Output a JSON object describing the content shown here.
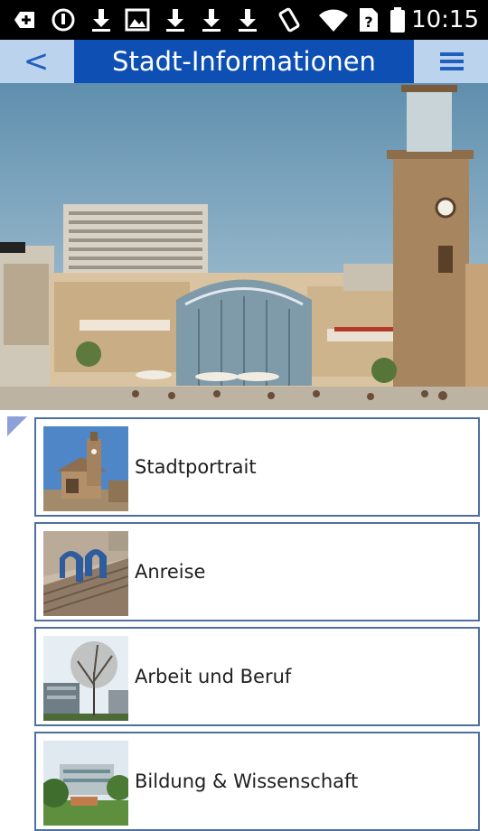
{
  "status_bar": {
    "time": "10:15",
    "icons": [
      "notification-plus-icon",
      "alarm-icon",
      "download-icon",
      "image-icon",
      "download-icon",
      "download-icon",
      "download-icon",
      "vibrate-icon",
      "wifi-icon",
      "sim-unknown-icon",
      "battery-icon"
    ]
  },
  "app_bar": {
    "back_label": "<",
    "title": "Stadt-Informationen",
    "menu_icon": "hamburger-menu-icon",
    "colors": {
      "bar": "#bcd3ee",
      "title_bg": "#0d4fb3",
      "accent": "#1f5fbf"
    }
  },
  "hero": {
    "image": "city-center-photo"
  },
  "menu_items": [
    {
      "label": "Stadtportrait",
      "thumb": "train-station-photo"
    },
    {
      "label": "Anreise",
      "thumb": "railway-sculpture-photo"
    },
    {
      "label": "Arbeit und Beruf",
      "thumb": "tree-building-photo"
    },
    {
      "label": "Bildung & Wissenschaft",
      "thumb": "campus-photo"
    }
  ]
}
